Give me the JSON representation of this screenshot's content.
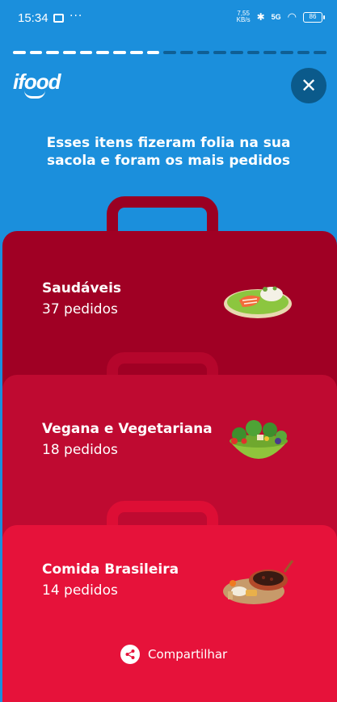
{
  "status_bar": {
    "time": "15:34",
    "net_speed_top": "7,55",
    "net_speed_bottom": "KB/s",
    "signal": "5G",
    "battery": "86"
  },
  "progress": {
    "completed_segments": 9,
    "total_segments": 19
  },
  "brand": {
    "logo_text": "ifood"
  },
  "headline": "Esses itens fizeram folia na sua sacola e foram os mais pedidos",
  "categories": [
    {
      "name": "Saudáveis",
      "count": "37 pedidos",
      "icon": "salmon-plate-icon",
      "color": "#a00024"
    },
    {
      "name": "Vegana e Vegetariana",
      "count": "18 pedidos",
      "icon": "salad-bowl-icon",
      "color": "#bf0a31"
    },
    {
      "name": "Comida Brasileira",
      "count": "14 pedidos",
      "icon": "feijoada-icon",
      "color": "#e6123a"
    }
  ],
  "share": {
    "label": "Compartilhar"
  },
  "colors": {
    "background": "#1b8fdc",
    "close_button": "#0b5a8b",
    "progress_done": "#ffffff",
    "progress_todo": "#0f5f94"
  }
}
